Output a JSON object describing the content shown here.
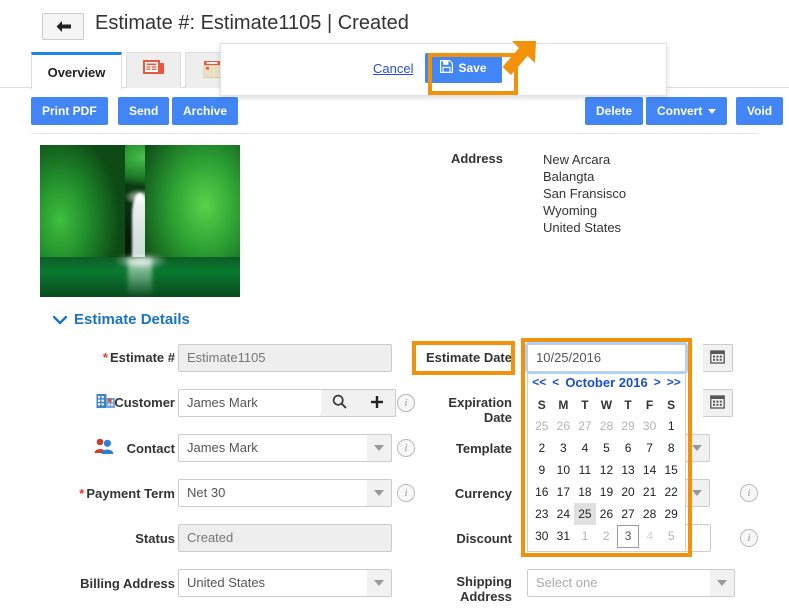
{
  "header": {
    "back_icon": "arrow-left-icon",
    "title": "Estimate #: Estimate1105 | Created"
  },
  "tabs": [
    {
      "label": "Overview",
      "icon": "",
      "active": true
    },
    {
      "label": "",
      "icon": "document-list-icon",
      "active": false
    },
    {
      "label": "",
      "icon": "calendar-icon",
      "active": false
    }
  ],
  "actions": {
    "print_pdf": "Print PDF",
    "send": "Send",
    "archive": "Archive",
    "delete": "Delete",
    "convert": "Convert",
    "void": "Void"
  },
  "save_popup": {
    "cancel_label": "Cancel",
    "save_label": "Save",
    "save_icon": "floppy-disk-icon",
    "highlight_color": "#f2910a"
  },
  "address": {
    "label": "Address",
    "lines": [
      "New Arcara",
      "Balangta",
      "San Fransisco",
      "Wyoming",
      "United States"
    ]
  },
  "section": {
    "title": "Estimate Details",
    "chevron_icon": "chevron-down-icon"
  },
  "form": {
    "estimate_number": {
      "label": "Estimate #",
      "required": true,
      "value": "Estimate1105",
      "readonly": true
    },
    "customer": {
      "label": "Customer",
      "required": true,
      "value": "James Mark",
      "icon": "building-icon",
      "search_icon": "search-icon",
      "add_icon": "plus-icon"
    },
    "contact": {
      "label": "Contact",
      "required": false,
      "value": "James Mark",
      "icon": "people-icon"
    },
    "payment_term": {
      "label": "Payment Term",
      "required": true,
      "value": "Net 30"
    },
    "status": {
      "label": "Status",
      "value": "Created",
      "readonly": true
    },
    "billing_address": {
      "label": "Billing Address",
      "value": "United States"
    },
    "estimate_date": {
      "label": "Estimate Date",
      "value": "10/25/2016",
      "calendar_icon": "calendar-icon"
    },
    "expiration_date": {
      "label": "Expiration Date",
      "value": "",
      "calendar_icon": "calendar-icon"
    },
    "template": {
      "label": "Template",
      "value": ""
    },
    "currency": {
      "label": "Currency",
      "value": ""
    },
    "discount": {
      "label": "Discount",
      "value": ""
    },
    "shipping_address": {
      "label": "Shipping\nAddress",
      "label_line1": "Shipping",
      "label_line2": "Address",
      "placeholder": "Select one",
      "value": ""
    }
  },
  "datepicker": {
    "month_label": "October 2016",
    "nav": {
      "prev_year": "<<",
      "prev_month": "<",
      "next_month": ">",
      "next_year": ">>"
    },
    "weekdays": [
      "S",
      "M",
      "T",
      "W",
      "T",
      "F",
      "S"
    ],
    "weeks": [
      [
        {
          "d": "25",
          "type": "other"
        },
        {
          "d": "26",
          "type": "other"
        },
        {
          "d": "27",
          "type": "other"
        },
        {
          "d": "28",
          "type": "other"
        },
        {
          "d": "29",
          "type": "other"
        },
        {
          "d": "30",
          "type": "other"
        },
        {
          "d": "1",
          "type": "cur"
        }
      ],
      [
        {
          "d": "2",
          "type": "cur"
        },
        {
          "d": "3",
          "type": "cur"
        },
        {
          "d": "4",
          "type": "cur"
        },
        {
          "d": "5",
          "type": "cur"
        },
        {
          "d": "6",
          "type": "cur"
        },
        {
          "d": "7",
          "type": "cur"
        },
        {
          "d": "8",
          "type": "cur"
        }
      ],
      [
        {
          "d": "9",
          "type": "cur"
        },
        {
          "d": "10",
          "type": "cur"
        },
        {
          "d": "11",
          "type": "cur"
        },
        {
          "d": "12",
          "type": "cur"
        },
        {
          "d": "13",
          "type": "cur"
        },
        {
          "d": "14",
          "type": "cur"
        },
        {
          "d": "15",
          "type": "cur"
        }
      ],
      [
        {
          "d": "16",
          "type": "cur"
        },
        {
          "d": "17",
          "type": "cur"
        },
        {
          "d": "18",
          "type": "cur"
        },
        {
          "d": "19",
          "type": "cur"
        },
        {
          "d": "20",
          "type": "cur"
        },
        {
          "d": "21",
          "type": "cur"
        },
        {
          "d": "22",
          "type": "cur"
        }
      ],
      [
        {
          "d": "23",
          "type": "cur"
        },
        {
          "d": "24",
          "type": "cur"
        },
        {
          "d": "25",
          "type": "sel"
        },
        {
          "d": "26",
          "type": "cur"
        },
        {
          "d": "27",
          "type": "cur"
        },
        {
          "d": "28",
          "type": "cur"
        },
        {
          "d": "29",
          "type": "cur"
        }
      ],
      [
        {
          "d": "30",
          "type": "cur"
        },
        {
          "d": "31",
          "type": "cur"
        },
        {
          "d": "1",
          "type": "other"
        },
        {
          "d": "2",
          "type": "other"
        },
        {
          "d": "3",
          "type": "today"
        },
        {
          "d": "4",
          "type": "dim"
        },
        {
          "d": "5",
          "type": "other"
        }
      ]
    ],
    "selected_day": "25",
    "today_day": "3"
  },
  "colors": {
    "primary_button": "#4285f4",
    "highlight": "#f2910a",
    "link": "#2b4fd1",
    "section_title": "#1a73c7",
    "tab_active_border": "#1e88e5",
    "required_star": "#e23b2e"
  }
}
